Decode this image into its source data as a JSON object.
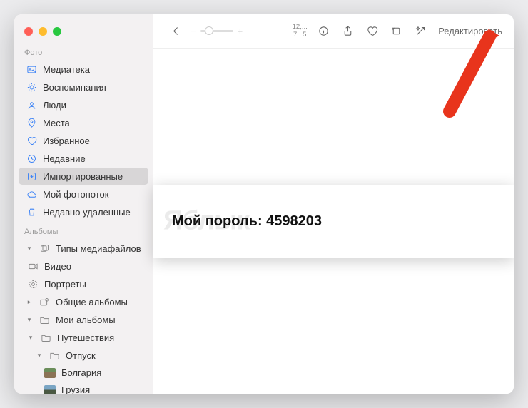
{
  "sidebar": {
    "section_photos": "Фото",
    "library": "Медиатека",
    "memories": "Воспоминания",
    "people": "Люди",
    "places": "Места",
    "favorites": "Избранное",
    "recent": "Недавние",
    "imported": "Импортированные",
    "photostream": "Мой фотопоток",
    "recently_deleted": "Недавно удаленные",
    "section_albums": "Альбомы",
    "media_types": "Типы медиафайлов",
    "video": "Видео",
    "portraits": "Портреты",
    "shared_albums": "Общие альбомы",
    "my_albums": "Мои альбомы",
    "travel": "Путешествия",
    "vacation": "Отпуск",
    "bulgaria": "Болгария",
    "georgia": "Грузия"
  },
  "toolbar": {
    "date_top": "12,...",
    "date_bottom": "7...5",
    "edit": "Редактировать",
    "zoom_minus": "−",
    "zoom_plus": "+"
  },
  "image": {
    "watermark": "Яблык",
    "text": "Мой пороль: 4598203"
  }
}
